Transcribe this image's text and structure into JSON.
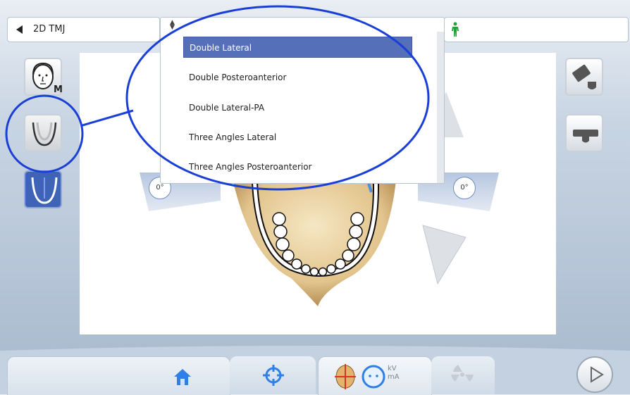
{
  "header": {
    "program_label": "2D TMJ",
    "back_icon": "triangle-left-icon",
    "patient_icon": "person-standing-icon"
  },
  "dropdown": {
    "items": [
      {
        "label": "Double Lateral",
        "selected": true
      },
      {
        "label": "Double Posteroanterior",
        "selected": false
      },
      {
        "label": "Double Lateral-PA",
        "selected": false
      },
      {
        "label": "Three Angles Lateral",
        "selected": false
      },
      {
        "label": "Three Angles Posteroanterior",
        "selected": false
      }
    ]
  },
  "side_buttons": {
    "head_badge": "M"
  },
  "angles": {
    "left": "0°",
    "right": "0°"
  },
  "bottom": {
    "params_kv": "kV",
    "params_ma": "mA"
  },
  "colors": {
    "accent": "#3f63b7",
    "highlight_circle": "#1a3fd6",
    "selected_item": "#5570b8",
    "patient_icon": "#22a33a"
  }
}
